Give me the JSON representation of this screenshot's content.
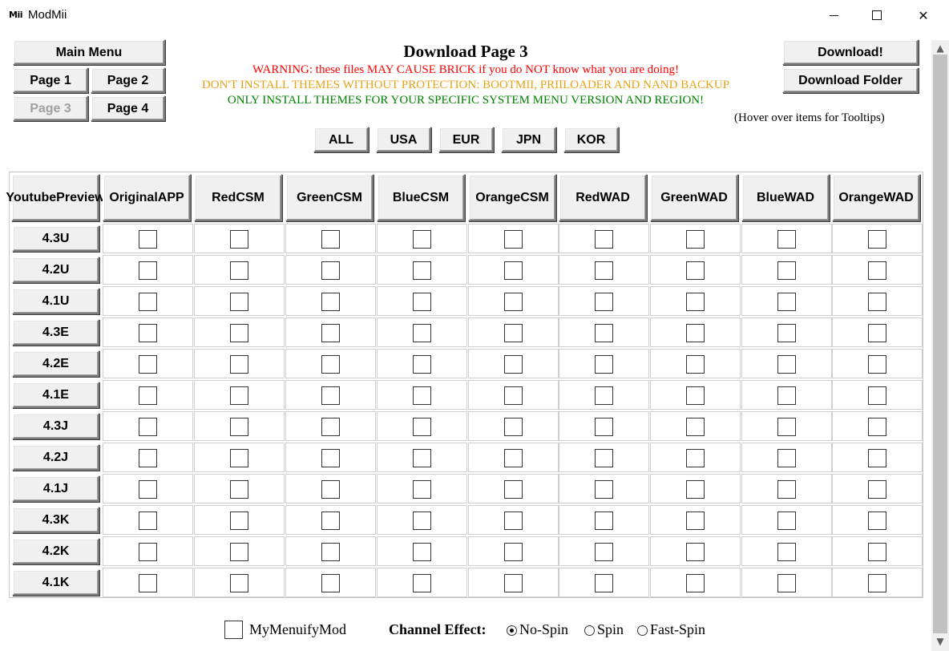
{
  "window": {
    "title": "ModMii",
    "icon_text": "Mii",
    "minimize_label": "",
    "maximize_label": "",
    "close_label": "✕"
  },
  "nav": {
    "main_menu": "Main Menu",
    "pages": [
      "Page 1",
      "Page 2",
      "Page 3",
      "Page 4"
    ],
    "current_page_index": 2
  },
  "actions": {
    "download": "Download!",
    "download_folder": "Download Folder"
  },
  "header": {
    "title": "Download Page 3",
    "warning_1": "WARNING: these files MAY CAUSE BRICK if you do NOT know what you are doing!",
    "warning_2": "DON'T INSTALL THEMES WITHOUT PROTECTION: BOOTMII, PRIILOADER AND NAND BACKUP",
    "warning_3": "ONLY INSTALL THEMES FOR YOUR SPECIFIC SYSTEM MENU VERSION AND REGION!",
    "hover_hint": "(Hover over items for Tooltips)",
    "colors": {
      "warning_1": "#ff0000",
      "warning_2": "#e8a317",
      "warning_3": "#008000"
    }
  },
  "region_filters": [
    "ALL",
    "USA",
    "EUR",
    "JPN",
    "KOR"
  ],
  "grid": {
    "row_header_title": [
      "Youtube",
      "Preview"
    ],
    "columns": [
      [
        "Original",
        "APP"
      ],
      [
        "Red",
        "CSM"
      ],
      [
        "Green",
        "CSM"
      ],
      [
        "Blue",
        "CSM"
      ],
      [
        "Orange",
        "CSM"
      ],
      [
        "Red",
        "WAD"
      ],
      [
        "Green",
        "WAD"
      ],
      [
        "Blue",
        "WAD"
      ],
      [
        "Orange",
        "WAD"
      ]
    ],
    "rows": [
      "4.3U",
      "4.2U",
      "4.1U",
      "4.3E",
      "4.2E",
      "4.1E",
      "4.3J",
      "4.2J",
      "4.1J",
      "4.3K",
      "4.2K",
      "4.1K"
    ],
    "checked": []
  },
  "footer": {
    "menuify_label": "MyMenuifyMod",
    "menuify_checked": false,
    "channel_effect_label": "Channel Effect:",
    "effects": [
      "No-Spin",
      "Spin",
      "Fast-Spin"
    ],
    "selected_effect_index": 0
  },
  "scrollbar": {
    "up_icon": "▲",
    "down_icon": "▼"
  }
}
